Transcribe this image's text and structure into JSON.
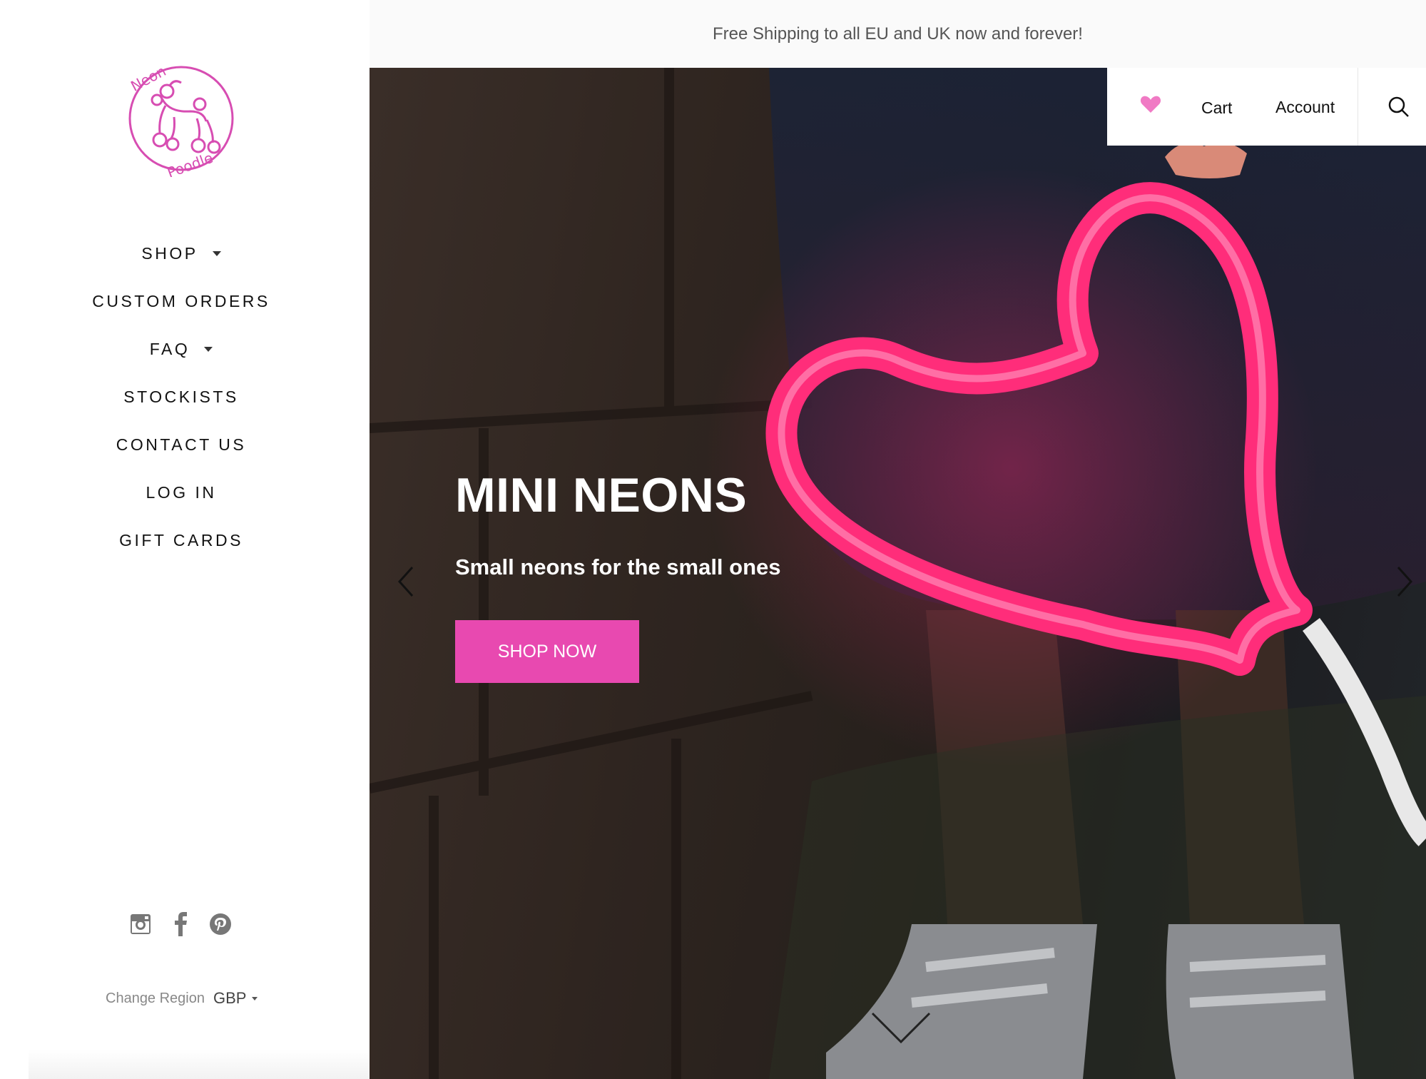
{
  "announcement": "Free Shipping to all EU and UK now and forever!",
  "brand": {
    "logo_text_top": "Neon",
    "logo_text_bottom": "Poodle",
    "accent": "#e849b0"
  },
  "sidebar": {
    "nav": [
      {
        "label": "SHOP",
        "dropdown": true
      },
      {
        "label": "CUSTOM ORDERS",
        "dropdown": false
      },
      {
        "label": "FAQ",
        "dropdown": true
      },
      {
        "label": "STOCKISTS",
        "dropdown": false
      },
      {
        "label": "CONTACT US",
        "dropdown": false
      },
      {
        "label": "LOG IN",
        "dropdown": false
      },
      {
        "label": "GIFT CARDS",
        "dropdown": false
      }
    ],
    "social": [
      "instagram-icon",
      "facebook-icon",
      "pinterest-icon"
    ],
    "region_label": "Change Region",
    "currency": "GBP"
  },
  "header": {
    "wishlist_icon": "heart-icon",
    "cart_label": "Cart",
    "account_label": "Account",
    "search_icon": "search-icon"
  },
  "hero": {
    "title": "MINI NEONS",
    "subtitle": "Small neons for the small ones",
    "cta": "SHOP NOW",
    "neon_color": "#ff2d7a"
  }
}
